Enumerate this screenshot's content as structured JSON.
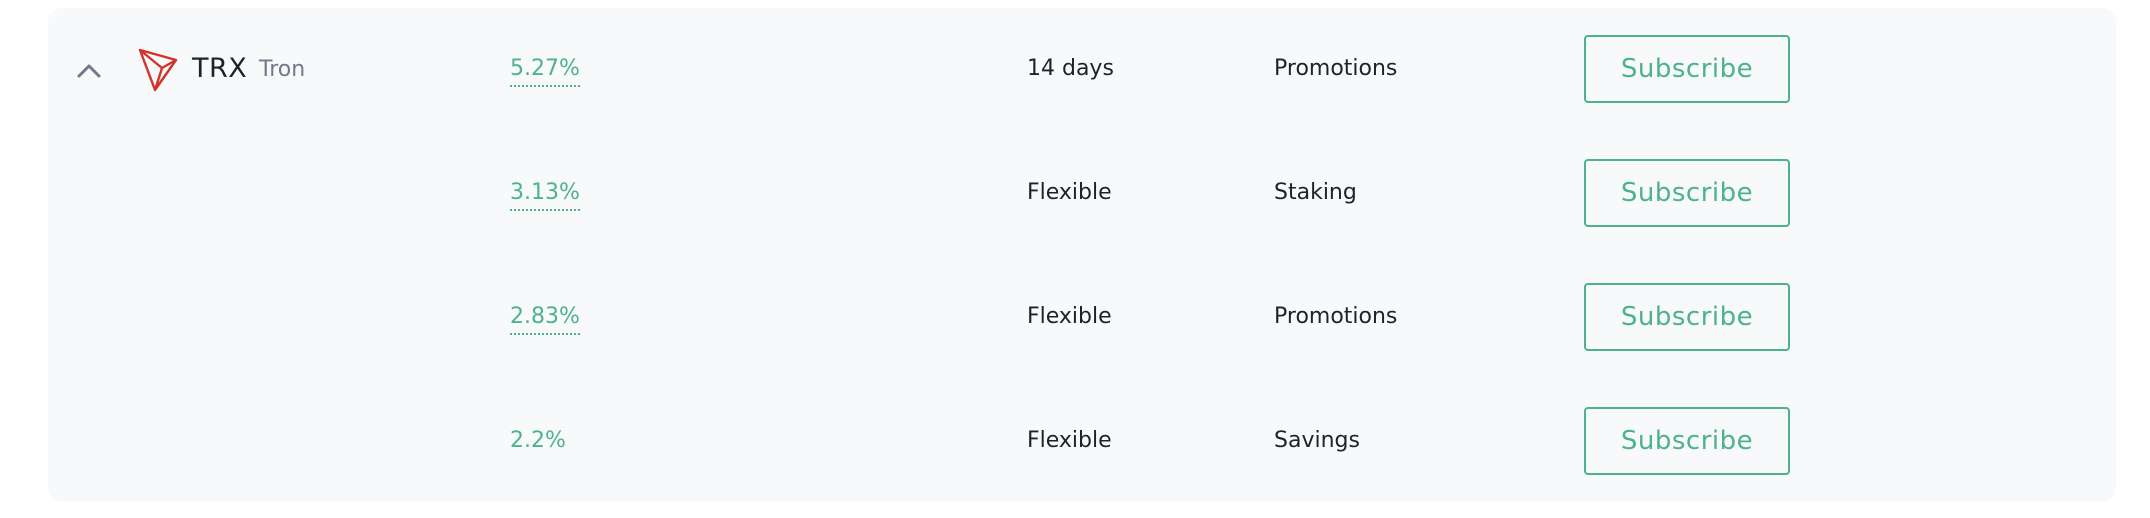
{
  "colors": {
    "accent": "#4db38a",
    "card_background": "#f7f9fb",
    "text_primary": "#1e2329",
    "text_secondary": "#707a8a",
    "tron_red": "#d2332b"
  },
  "coin": {
    "symbol": "TRX",
    "name": "Tron",
    "icon": "tron-logo",
    "expand_icon": "chevron-up-icon"
  },
  "products": [
    {
      "apy": "5.27%",
      "duration": "14 days",
      "type": "Promotions",
      "action_label": "Subscribe"
    },
    {
      "apy": "3.13%",
      "duration": "Flexible",
      "type": "Staking",
      "action_label": "Subscribe"
    },
    {
      "apy": "2.83%",
      "duration": "Flexible",
      "type": "Promotions",
      "action_label": "Subscribe"
    },
    {
      "apy": "2.2%",
      "duration": "Flexible",
      "type": "Savings",
      "action_label": "Subscribe"
    }
  ]
}
